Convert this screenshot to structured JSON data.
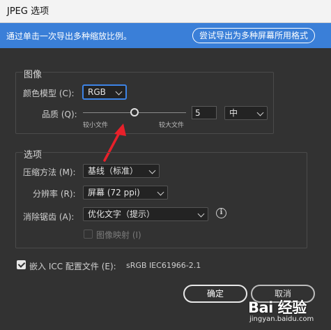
{
  "window": {
    "title": "JPEG 选项"
  },
  "banner": {
    "text": "通过单击一次导出多种缩放比例。",
    "button_label": "尝试导出为多种屏幕所用格式"
  },
  "image_group": {
    "title": "图像",
    "color_model_label": "颜色模型 (C):",
    "color_model_value": "RGB",
    "quality_label": "品质 (Q):",
    "quality_value": "5",
    "quality_level": "中",
    "quality_min_label": "较小文件",
    "quality_max_label": "较大文件",
    "quality_fraction": 0.5
  },
  "options_group": {
    "title": "选项",
    "compression_label": "压缩方法 (M):",
    "compression_value": "基线（标准）",
    "resolution_label": "分辨率 (R):",
    "resolution_value": "屏幕 (72 ppi)",
    "antialias_label": "消除锯齿 (A):",
    "antialias_value": "优化文字（提示）",
    "imagemap_label": "图像映射 (I)",
    "imagemap_checked": false
  },
  "icc": {
    "label": "嵌入 ICC 配置文件 (E):",
    "profile": "sRGB IEC61966-2.1",
    "checked": true
  },
  "buttons": {
    "ok": "确定",
    "cancel": "取消"
  },
  "watermark": {
    "brand": "Bai 经验",
    "url": "jingyan.baidu.com"
  },
  "colors": {
    "accent": "#3a7fd8",
    "background": "#323232",
    "arrow": "#e8202a"
  },
  "icons": [
    "info-icon",
    "chevron-down-icon",
    "check-icon",
    "annotation-arrow"
  ]
}
